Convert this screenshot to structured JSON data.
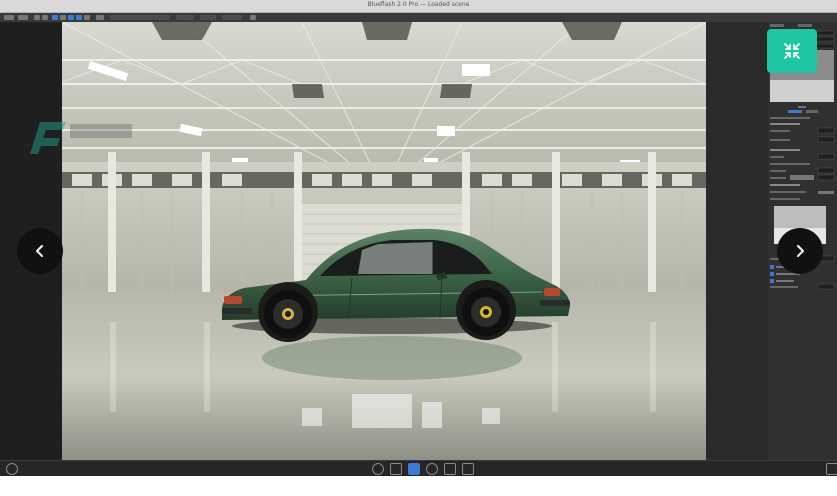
{
  "window": {
    "title": "Blueflash 2.0 Pro — Loaded scene"
  },
  "controls": {
    "prev_icon": "chevron-left-icon",
    "next_icon": "chevron-right-icon",
    "fullscreen_icon": "fullscreen-exit-icon"
  },
  "colors": {
    "accent": "#1ec6a1",
    "car_green": "#3f6b4a",
    "nav_button": "#111111",
    "active_tool": "#3a7bd5"
  }
}
